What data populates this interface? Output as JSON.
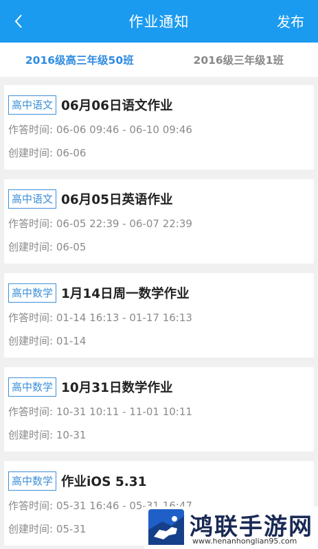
{
  "header": {
    "title": "作业通知",
    "publish_label": "发布",
    "back_icon": "chevron-left-icon"
  },
  "tabs": [
    {
      "label": "2016级高三年级50班",
      "active": true
    },
    {
      "label": "2016级三年级1班",
      "active": false
    }
  ],
  "assignments": [
    {
      "subject": "高中语文",
      "title": "06月06日语文作业",
      "answer_time": "作答时间: 06-06 09:46 - 06-10 09:46",
      "created": "创建时间: 06-06"
    },
    {
      "subject": "高中语文",
      "title": "06月05日英语作业",
      "answer_time": "作答时间: 06-05 22:39 - 06-07 22:39",
      "created": "创建时间: 06-05"
    },
    {
      "subject": "高中数学",
      "title": "1月14日周一数学作业",
      "answer_time": "作答时间: 01-14 16:13 - 01-17 16:13",
      "created": "创建时间: 01-14"
    },
    {
      "subject": "高中数学",
      "title": "10月31日数学作业",
      "answer_time": "作答时间: 10-31 10:11 - 11-01 10:11",
      "created": "创建时间: 10-31"
    },
    {
      "subject": "高中数学",
      "title": "作业iOS 5.31",
      "answer_time": "作答时间: 05-31 16:46 - 05-31 16:47",
      "created": "创建时间: 05-31"
    }
  ],
  "watermark": {
    "name": "鸿联手游网",
    "url": "www.henanhonglian95.com"
  },
  "colors": {
    "navbar": "#1b9bf0",
    "accent": "#2f8be0",
    "tag_border": "#3d8fd8"
  }
}
